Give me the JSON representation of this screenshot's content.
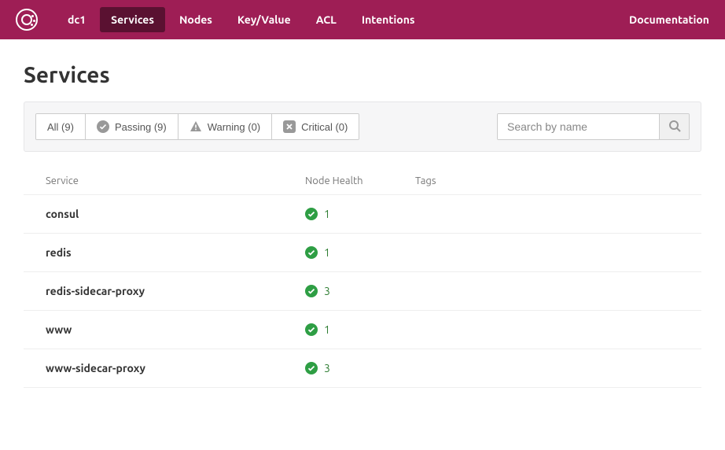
{
  "nav": {
    "datacenter": "dc1",
    "items": [
      "Services",
      "Nodes",
      "Key/Value",
      "ACL",
      "Intentions"
    ],
    "active": "Services",
    "docs": "Documentation"
  },
  "page": {
    "title": "Services"
  },
  "filters": {
    "all": "All (9)",
    "passing": "Passing (9)",
    "warning": "Warning (0)",
    "critical": "Critical (0)"
  },
  "search": {
    "placeholder": "Search by name"
  },
  "table": {
    "headers": {
      "service": "Service",
      "health": "Node Health",
      "tags": "Tags"
    },
    "rows": [
      {
        "name": "consul",
        "health": 1
      },
      {
        "name": "redis",
        "health": 1
      },
      {
        "name": "redis-sidecar-proxy",
        "health": 3
      },
      {
        "name": "www",
        "health": 1
      },
      {
        "name": "www-sidecar-proxy",
        "health": 3
      }
    ]
  },
  "colors": {
    "brand": "#9e1e55",
    "ok": "#2e9e44"
  }
}
